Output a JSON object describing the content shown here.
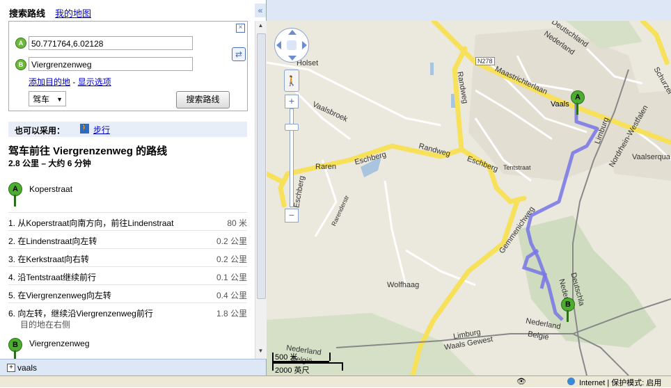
{
  "tabs": {
    "search_route": "搜索路线",
    "my_maps": "我的地图",
    "collapse": "«"
  },
  "directions": {
    "close": "×",
    "from_marker": "A",
    "from_value": "50.771764,6.02128",
    "to_marker": "B",
    "to_value": "Viergrenzenweg",
    "swap_icon": "⇄",
    "add_destination": "添加目的地",
    "separator": " - ",
    "show_options": "显示选项",
    "mode_selected": "驾车",
    "mode_arrow": "▼",
    "search_button": "搜索路线"
  },
  "also": {
    "label": "也可以采用：",
    "walk_icon": "🚶",
    "walk_link": "步行"
  },
  "route": {
    "title": "驾车前往 Viergrenzenweg 的路线",
    "summary": "2.8 公里 – 大约 6 分钟",
    "start_marker": "A",
    "start_label": "Koperstraat",
    "end_marker": "B",
    "end_label": "Viergrenzenweg",
    "steps": [
      {
        "text": "1. 从Koperstraat向南方向，前往Lindenstraat",
        "dist": "80 米"
      },
      {
        "text": "2. 在Lindenstraat向左转",
        "dist": "0.2 公里"
      },
      {
        "text": "3. 在Kerkstraat向右转",
        "dist": "0.2 公里"
      },
      {
        "text": "4. 沿Tentstraat继续前行",
        "dist": "0.1 公里"
      },
      {
        "text": "5. 在Viergrenzenweg向左转",
        "dist": "0.4 公里"
      },
      {
        "text": "6. 向左转，继续沿Viergrenzenweg前行",
        "dist": "1.8 公里",
        "sub": "目的地在右侧"
      }
    ]
  },
  "bottom": {
    "plus": "+",
    "label": "vaals"
  },
  "scrollbar": {
    "up": "▲",
    "down": "▼"
  },
  "map": {
    "labels": {
      "holset": "Holset",
      "vaals": "Vaals",
      "vaalsbroek": "Vaalsbroek",
      "raren": "Raren",
      "randweg": "Randweg",
      "randweg2": "Randweg",
      "eschberg": "Eschberg",
      "eschberg2": "Eschberg",
      "eschberg3": "Eschberg",
      "n278": "N278",
      "maastrichterlaan": "Maastrichterlaan",
      "tentstraat": "Tentstraat",
      "limburg": "Limburg",
      "nordrhein": "Nordrhein-Westfalen",
      "vaalserquartier": "Vaalserqua",
      "gemmenich": "Gemmenichweg",
      "wolfhaag": "Wolfhaag",
      "nederland": "Nederland",
      "belgie": "België",
      "limburg2": "Limburg",
      "waals": "Waals Gewest",
      "deutschland": "Deutschland",
      "nederland2": "Nederland",
      "deutschland2": "Deutschla",
      "nederland3": "Neder",
      "nederland4": "Nederland",
      "belgie2": "België",
      "schurzelt": "Schurzel",
      "rarendaerstr": "Rarenderstr",
      "marker_a": "A",
      "marker_b": "B"
    },
    "scale": {
      "metric": "500 米",
      "imperial": "2000 英尺"
    },
    "controls": {
      "plus": "+",
      "minus": "−",
      "person": "🚶"
    }
  },
  "status": {
    "eye": "👁",
    "text": "Internet | 保护模式: 启用"
  }
}
